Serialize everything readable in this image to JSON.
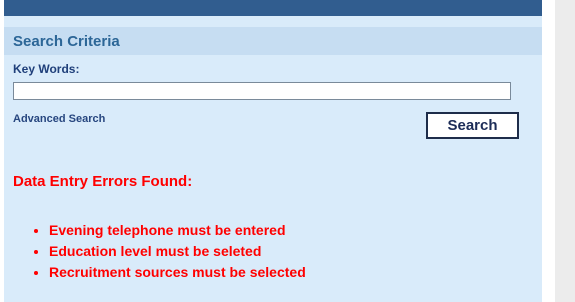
{
  "search_panel": {
    "title": "Search Criteria",
    "keywords_label": "Key Words:",
    "keywords_value": "",
    "advanced_search_link": "Advanced Search",
    "search_button": "Search"
  },
  "errors": {
    "title": "Data Entry Errors Found:",
    "items": [
      "Evening telephone must be entered",
      "Education level must be seleted",
      "Recruitment sources must be selected"
    ]
  },
  "colors": {
    "top_bar": "#315d8f",
    "panel_background": "#d9ebfa",
    "header_background": "#c6ddf2",
    "title_text": "#2c6697",
    "error_text": "#ff0000"
  }
}
